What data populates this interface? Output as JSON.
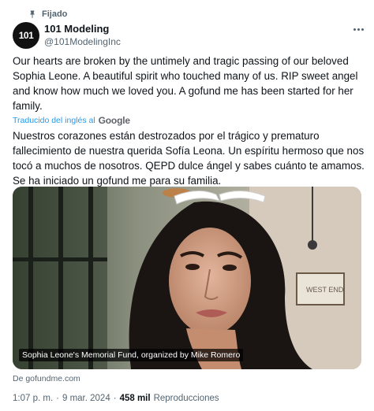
{
  "pinned_label": "Fijado",
  "author": {
    "avatar_text": "101",
    "name": "101 Modeling",
    "handle": "@101ModelingInc"
  },
  "tweet": {
    "text_original": "Our hearts are broken by the untimely and tragic passing of our beloved Sophia Leone. A beautiful spirit who touched many of us. RIP sweet angel and know how much we loved you. A gofund me has been started for her family.",
    "translated_label": "Traducido del inglés al",
    "translated_brand": "Google",
    "text_translated": "Nuestros corazones están destrozados por el trágico y prematuro fallecimiento de nuestra querida Sofía Leona. Un espíritu hermoso que nos tocó a muchos de nosotros. QEPD dulce ángel y sabes cuánto te amamos. Se ha iniciado un gofund me para su familia."
  },
  "card": {
    "caption": "Sophia Leone's Memorial Fund, organized by Mike Romero",
    "source": "De gofundme.com",
    "sign_text": "WEST END"
  },
  "meta": {
    "time": "1:07 p. m.",
    "separator": "·",
    "date": "9 mar. 2024",
    "views_count": "458 mil",
    "views_label": "Reproducciones"
  },
  "icons": {
    "pin": "pin-icon",
    "more": "more-icon"
  }
}
